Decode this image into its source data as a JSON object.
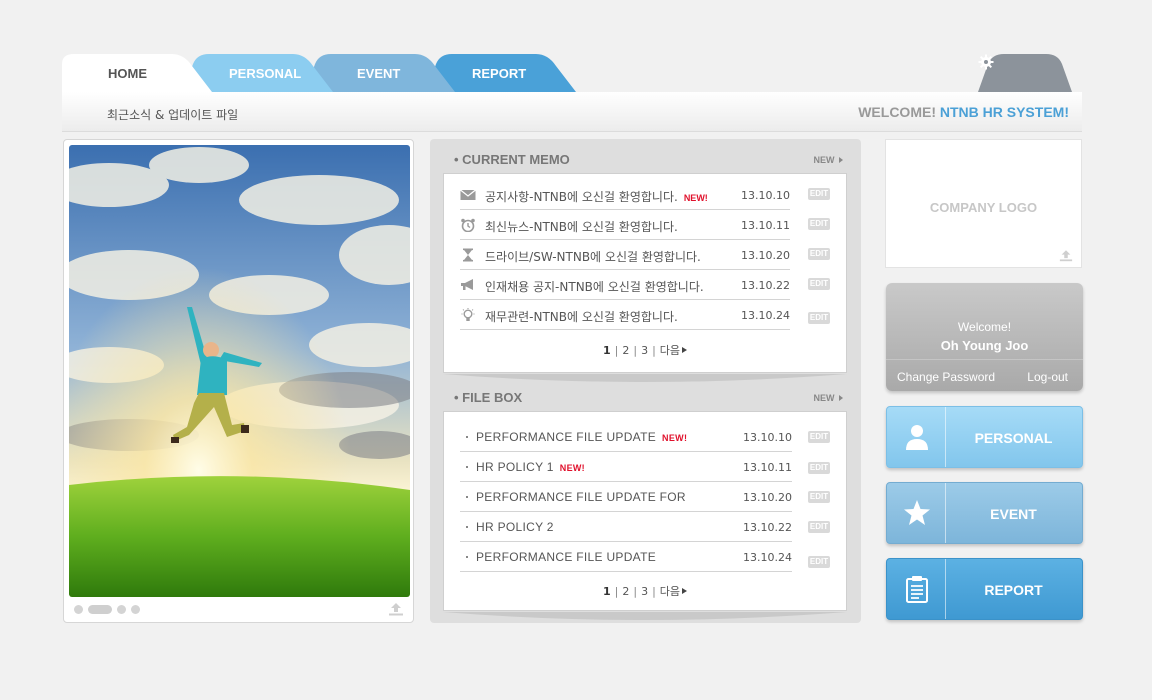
{
  "tabs": [
    {
      "label": "HOME",
      "color": "#ffffff"
    },
    {
      "label": "PERSONAL",
      "color": "#8ccdf0"
    },
    {
      "label": "EVENT",
      "color": "#7fb6dc"
    },
    {
      "label": "REPORT",
      "color": "#4aa1d8"
    }
  ],
  "header": {
    "subtitle": "최근소식 & 업데이트 파일",
    "welcome_prefix": "WELCOME!",
    "welcome_system": "NTNB HR SYSTEM!"
  },
  "memo": {
    "title": "• CURRENT MEMO",
    "new_link": "NEW",
    "items": [
      {
        "icon": "envelope-icon",
        "text": "공지사항-NTNB에 오신걸 환영합니다.",
        "badge": "NEW!",
        "date": "13.10.10",
        "edit": "EDIT"
      },
      {
        "icon": "alarm-clock-icon",
        "text": "최신뉴스-NTNB에 오신걸 환영합니다.",
        "badge": "",
        "date": "13.10.11",
        "edit": "EDIT"
      },
      {
        "icon": "hourglass-icon",
        "text": "드라이브/SW-NTNB에 오신걸 환영합니다.",
        "badge": "",
        "date": "13.10.20",
        "edit": "EDIT"
      },
      {
        "icon": "megaphone-icon",
        "text": "인재채용 공지-NTNB에 오신걸 환영합니다.",
        "badge": "",
        "date": "13.10.22",
        "edit": "EDIT"
      },
      {
        "icon": "lightbulb-icon",
        "text": "재무관련-NTNB에 오신걸 환영합니다.",
        "badge": "",
        "date": "13.10.24",
        "edit": "EDIT"
      }
    ],
    "pager": {
      "pages": [
        "1",
        "2",
        "3"
      ],
      "next": "다음"
    }
  },
  "filebox": {
    "title": "• FILE BOX",
    "new_link": "NEW",
    "items": [
      {
        "text": "PERFORMANCE FILE UPDATE",
        "badge": "NEW!",
        "date": "13.10.10",
        "edit": "EDIT"
      },
      {
        "text": "HR POLICY 1",
        "badge": "NEW!",
        "date": "13.10.11",
        "edit": "EDIT"
      },
      {
        "text": "PERFORMANCE FILE UPDATE FOR",
        "badge": "",
        "date": "13.10.20",
        "edit": "EDIT"
      },
      {
        "text": "HR POLICY 2",
        "badge": "",
        "date": "13.10.22",
        "edit": "EDIT"
      },
      {
        "text": "PERFORMANCE FILE UPDATE",
        "badge": "",
        "date": "13.10.24",
        "edit": "EDIT"
      }
    ],
    "pager": {
      "pages": [
        "1",
        "2",
        "3"
      ],
      "next": "다음"
    }
  },
  "slideshow": {
    "dots": 4,
    "active_index": 1
  },
  "logo": {
    "text": "COMPANY LOGO"
  },
  "user": {
    "welcome": "Welcome!",
    "name": "Oh Young Joo",
    "change_password": "Change Password",
    "logout": "Log-out"
  },
  "nav_buttons": [
    {
      "label": "PERSONAL",
      "icon": "person-icon"
    },
    {
      "label": "EVENT",
      "icon": "star-icon"
    },
    {
      "label": "REPORT",
      "icon": "clipboard-icon"
    }
  ]
}
